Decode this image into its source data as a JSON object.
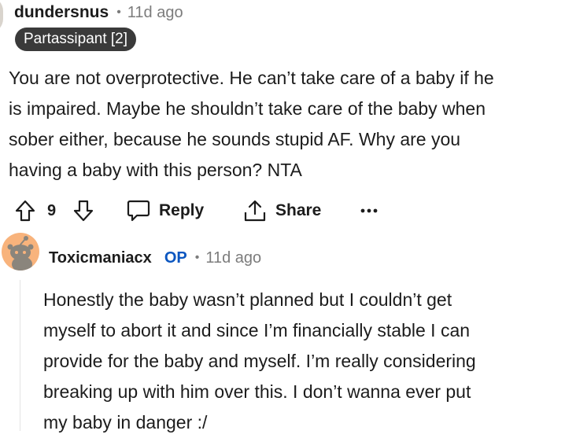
{
  "comment": {
    "author": "dundersnus",
    "separator": "•",
    "time": "11d ago",
    "flair": "Partassipant [2]",
    "lines": [
      "You are not overprotective. He can’t take care of a baby if he",
      "is impaired. Maybe he shouldn’t take care of the baby when",
      "sober either, because he sounds stupid AF. Why are you",
      "having a baby with this person? NTA"
    ],
    "actions": {
      "upvote_icon": "upvote-arrow-icon",
      "vote_count": "9",
      "downvote_icon": "downvote-arrow-icon",
      "reply_icon": "speech-bubble-icon",
      "reply_label": "Reply",
      "share_icon": "share-upload-icon",
      "share_label": "Share",
      "more_icon": "ellipsis-icon"
    }
  },
  "reply": {
    "author": "Toxicmaniacx",
    "op_badge": "OP",
    "separator": "•",
    "time": "11d ago",
    "lines": [
      "Honestly the baby wasn’t planned but I couldn’t get",
      "myself to abort it and since I’m financially stable I can",
      "provide for the baby and myself. I’m really considering",
      "breaking up with him over this. I don’t wanna ever put",
      "my baby in danger :/"
    ]
  },
  "colors": {
    "text": "#1c1c1c",
    "muted": "#7c7c7c",
    "flair_bg": "#3a3a3a",
    "op_blue": "#0b56c0",
    "avatar_orange": "#f8b37c"
  }
}
